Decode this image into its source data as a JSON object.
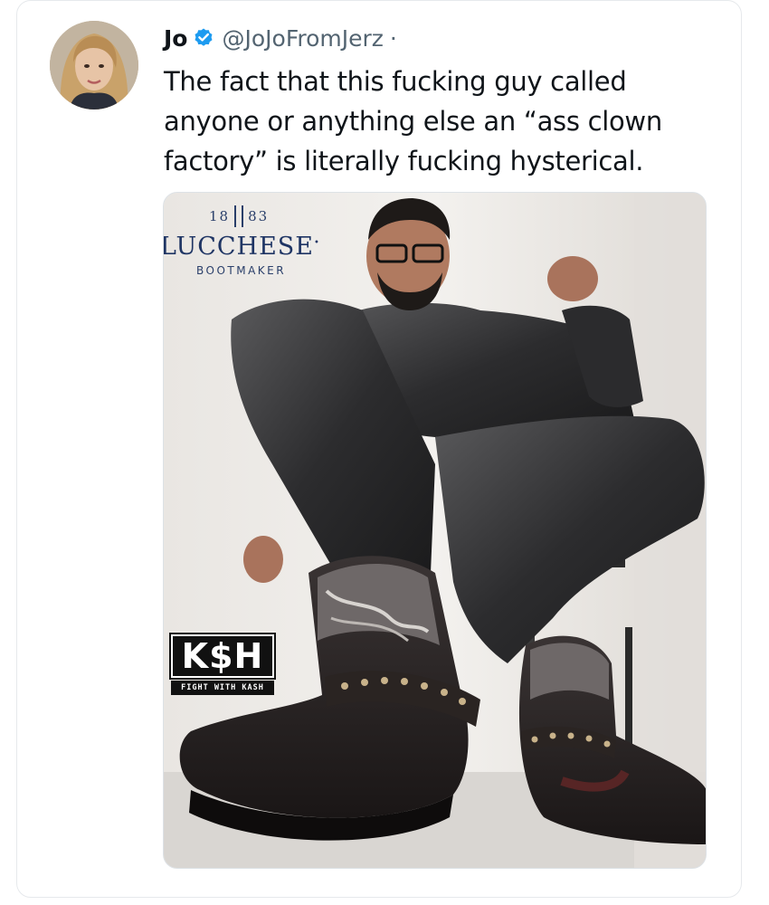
{
  "tweet": {
    "display_name": "Jo",
    "handle": "@JoJoFromJerz",
    "separator": "·",
    "text_lines": [
      "The fact that this fucking guy called",
      "anyone or anything else an “ass clown",
      "factory” is literally fucking hysterical."
    ],
    "verified_color": "#1d9bf0"
  },
  "media": {
    "brand": {
      "year_left": "18",
      "year_right": "83",
      "name": "LUCCHESE",
      "registered": "•",
      "tagline": "BOOTMAKER"
    },
    "watermark": {
      "main": "K$H",
      "tagline": "FIGHT WITH KASH"
    }
  },
  "icons": {
    "verified": "verified-badge-icon"
  }
}
